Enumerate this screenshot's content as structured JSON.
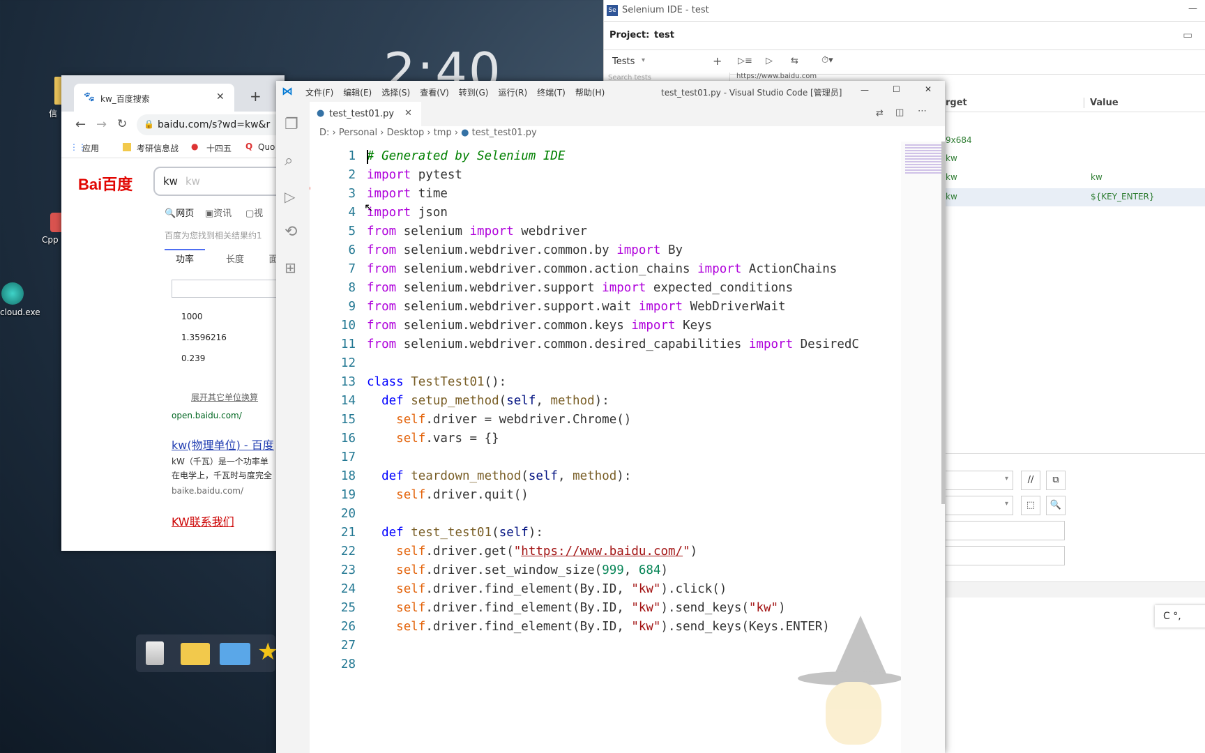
{
  "desktop": {
    "clock": "2:40",
    "icons": [
      {
        "label": "信",
        "icon": "folder-icon"
      },
      {
        "label": "Cpp",
        "icon": "app-icon"
      },
      {
        "label": "cloud.exe",
        "icon": "cloud-app-icon"
      }
    ]
  },
  "chrome": {
    "tab_title": "kw_百度搜索",
    "address": "baidu.com/s?wd=kw&r",
    "bookmarks": [
      "应用",
      "考研信息战",
      "十四五",
      "Quo"
    ],
    "logo": "Bai百度",
    "search_value": "kw",
    "search_hint": "kw",
    "tabs": [
      "网页",
      "资讯",
      "视"
    ],
    "result_count": "百度为您找到相关结果约1",
    "converter_tabs": [
      "功率",
      "长度",
      "面"
    ],
    "converter_rows": [
      "1000",
      "1.3596216",
      "0.239"
    ],
    "more_units": "展开其它单位换算",
    "source1": "open.baidu.com/",
    "result1_title": "kw(物理单位) - 百度",
    "result1_line1": "kW（千瓦）是一个功率单",
    "result1_line2": "在电学上，千瓦时与度完全",
    "source2": "baike.baidu.com/",
    "result2_title": "KW联系我们"
  },
  "selenium": {
    "window_title": "Selenium IDE - test",
    "project_label": "Project:",
    "project_name": "test",
    "tests_label": "Tests",
    "search_placeholder": "Search tests",
    "url_value": "https://www.baidu.com",
    "col_target": "rget",
    "col_value": "Value",
    "rows": [
      {
        "target": "9x684",
        "value": ""
      },
      {
        "target": "kw",
        "value": ""
      },
      {
        "target": "kw",
        "value": "kw"
      },
      {
        "target": "kw",
        "value": "${KEY_ENTER}"
      }
    ],
    "ime": "C °,"
  },
  "vscode": {
    "menu": [
      "文件(F)",
      "编辑(E)",
      "选择(S)",
      "查看(V)",
      "转到(G)",
      "运行(R)",
      "终端(T)",
      "帮助(H)"
    ],
    "title": "test_test01.py - Visual Studio Code [管理员]",
    "tab": "test_test01.py",
    "breadcrumb": [
      "D:",
      "Personal",
      "Desktop",
      "tmp",
      "test_test01.py"
    ],
    "line_numbers": [
      "1",
      "2",
      "3",
      "4",
      "5",
      "6",
      "7",
      "8",
      "9",
      "10",
      "11",
      "12",
      "13",
      "14",
      "15",
      "16",
      "17",
      "18",
      "19",
      "20",
      "21",
      "22",
      "23",
      "24",
      "25",
      "26",
      "27",
      "28"
    ]
  }
}
